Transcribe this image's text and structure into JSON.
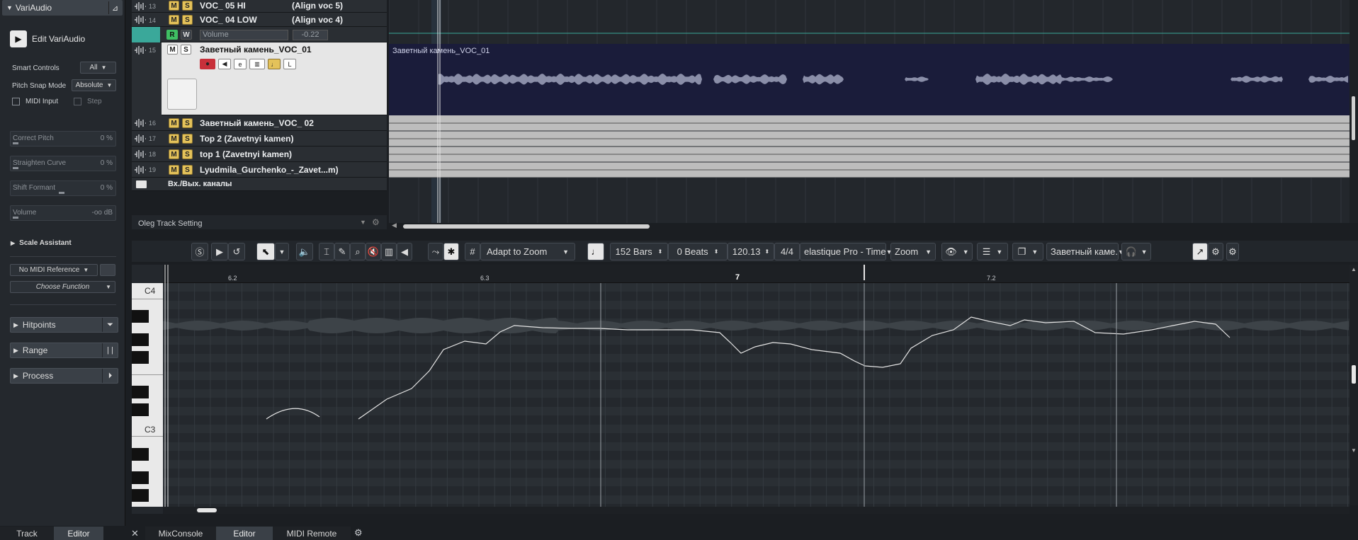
{
  "inspector": {
    "header": "VariAudio",
    "edit_label": "Edit VariAudio",
    "smart_controls_label": "Smart Controls",
    "smart_controls_value": "All",
    "pitch_snap_label": "Pitch Snap Mode",
    "pitch_snap_value": "Absolute",
    "midi_input_label": "MIDI Input",
    "step_label": "Step",
    "sliders": [
      {
        "name": "Correct Pitch",
        "value": "0 %"
      },
      {
        "name": "Straighten Curve",
        "value": "0 %"
      },
      {
        "name": "Shift Formant",
        "value": "0 %"
      },
      {
        "name": "Volume",
        "value": "-oo dB"
      }
    ],
    "scale_assistant": "Scale Assistant",
    "midi_reference": "No MIDI Reference",
    "choose_function": "Choose Function",
    "sections": [
      {
        "label": "Hitpoints"
      },
      {
        "label": "Range"
      },
      {
        "label": "Process"
      }
    ]
  },
  "bottom_left_tabs": [
    {
      "label": "Track"
    },
    {
      "label": "Editor"
    }
  ],
  "bottom_tabs": [
    {
      "label": "MixConsole"
    },
    {
      "label": "Editor"
    },
    {
      "label": "MIDI Remote"
    }
  ],
  "tracks": [
    {
      "num": "13",
      "name": "VOC_ 05 HI",
      "extra": "(Align voc 5)"
    },
    {
      "num": "14",
      "name": "VOC_ 04 LOW",
      "extra": "(Align voc 4)"
    },
    {
      "num": "15",
      "name": "Заветный камень_VOC_01"
    },
    {
      "num": "16",
      "name": "Заветный камень_VOC_ 02"
    },
    {
      "num": "17",
      "name": "Top 2 (Zavetnyi kamen)"
    },
    {
      "num": "18",
      "name": "top 1 (Zavetnyi kamen)"
    },
    {
      "num": "19",
      "name": "Lyudmila_Gurchenko_-_Zavet...m)"
    }
  ],
  "automation": {
    "r": "R",
    "w": "W",
    "param": "Volume",
    "value": "-0.22"
  },
  "folder_label": "Вх./Вых. каналы",
  "track_setting": "Oleg Track Setting",
  "clip_label": "Заветный камень_VOC_01",
  "toolbar": {
    "zoom_mode": "Adapt to Zoom",
    "bars": "152 Bars",
    "beats": "0 Beats",
    "tempo": "120.13",
    "signature": "4/4",
    "algorithm": "elastique Pro - Time",
    "zoom": "Zoom",
    "clip": "Заветный каме."
  },
  "ruler": [
    "6.2",
    "6.3",
    "7",
    "7.2"
  ],
  "notes": [
    "C4",
    "C3"
  ],
  "colors": {
    "accent_yellow": "#e4c25a",
    "record_red": "#c8303a",
    "clip_bg": "#1a1c3a",
    "teal": "#3aa89a"
  }
}
